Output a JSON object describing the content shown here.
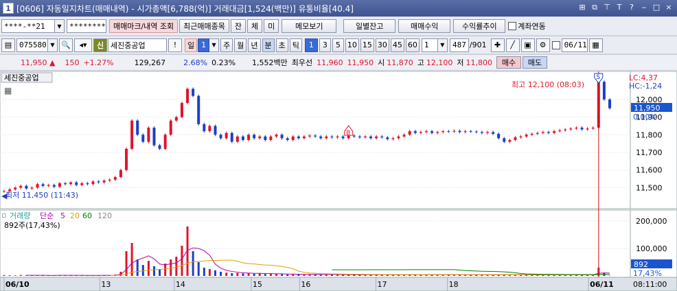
{
  "window": {
    "number": "1",
    "title": "[0606] 자동일지차트(매매내역) - 시가총액[6,788(억)] 거래대금[1,524(백만)] 유통비율[40.4]",
    "controls": [
      "⊞",
      "⧉",
      "⊤",
      "T",
      "?",
      "‒",
      "□",
      "×"
    ]
  },
  "toolbar1": {
    "account": "****-**21",
    "password": "********",
    "btn_trade_mark": "매매마크/내역 조회",
    "btn_recent": "최근매매종목",
    "btn_jan": "잔",
    "btn_che": "체",
    "btn_mi": "미",
    "btn_memo": "메모보기",
    "btn_daily_balance": "일별잔고",
    "btn_trade_profit": "매매수익",
    "btn_return_trend": "수익률추이",
    "account_link_label": "계좌연동"
  },
  "toolbar2": {
    "code": "075580",
    "badge": "신",
    "stock_name": "세진중공업",
    "excl": "!",
    "period_day": "일",
    "period_num": "1",
    "periods": [
      "주",
      "월",
      "년",
      "분",
      "초",
      "틱"
    ],
    "intervals": [
      "1",
      "3",
      "5",
      "10",
      "15",
      "30",
      "45",
      "60"
    ],
    "interval_input": "1",
    "count": "487",
    "total": "/901",
    "date": "06/11"
  },
  "quote": {
    "price": "11,950 ▲",
    "change": "150",
    "change_pct": "+1.27%",
    "volume": "129,267",
    "vol_ratio": "2.68%",
    "turnover": "0.23%",
    "amount": "1,552백만",
    "best_ask_label": "최우선",
    "best_ask": "11,960",
    "best_bid": "11,950",
    "open_label": "시",
    "open": "11,870",
    "high_label": "고",
    "high": "12,100",
    "low_label": "저",
    "low": "11,800",
    "buy_btn": "매수",
    "sell_btn": "매도"
  },
  "chart": {
    "stock_label": "세진중공업",
    "high_annot": "최고 12,100 (08:03)",
    "low_annot": "최저 11,450 (11:43)",
    "lc": "LC:4,37",
    "hc": "HC:-1,24",
    "current_price_tag": "11,950",
    "current_pct_tag": "0,00%",
    "volume_legend": {
      "title": "거래량",
      "ma_label": "단순",
      "ma": [
        "5",
        "20",
        "60",
        "120"
      ],
      "ma_colors": [
        "#b000b0",
        "#e0a000",
        "#008000",
        "#888888"
      ]
    },
    "volume_info": "892주(17,43%)",
    "volume_tag": "892",
    "volume_pct_tag": "17,43%",
    "date_labels": [
      "06/10",
      "13",
      "14",
      "15",
      "16",
      "17",
      "18",
      "06/11"
    ],
    "time_label": "08:11:00",
    "marker_b": "B",
    "marker_s": "S"
  },
  "chart_data": {
    "type": "line",
    "title": "",
    "price_axis": {
      "ticks": [
        11500,
        11600,
        11700,
        11800,
        11900,
        12000
      ],
      "ylim": [
        11420,
        12120
      ]
    },
    "volume_axis": {
      "ticks": [
        100000,
        200000
      ],
      "ylim": [
        0,
        220000
      ]
    },
    "x_labels": [
      "06/10",
      "13",
      "14",
      "15",
      "16",
      "17",
      "18",
      "06/11"
    ],
    "price_series": [
      11480,
      11490,
      11500,
      11510,
      11495,
      11500,
      11520,
      11510,
      11515,
      11505,
      11525,
      11520,
      11530,
      11515,
      11525,
      11520,
      11535,
      11530,
      11540,
      11545,
      11560,
      11600,
      11720,
      11880,
      11800,
      11760,
      11840,
      11740,
      11720,
      11800,
      11880,
      11900,
      11980,
      12060,
      12020,
      11860,
      11820,
      11850,
      11800,
      11780,
      11810,
      11760,
      11790,
      11770,
      11800,
      11780,
      11790,
      11770,
      11790,
      11800,
      11780,
      11770,
      11790,
      11780,
      11790,
      11795,
      11790,
      11780,
      11790,
      11785,
      11790,
      11780,
      11795,
      11790,
      11785,
      11790,
      11780,
      11790,
      11785,
      11775,
      11780,
      11790,
      11800,
      11820,
      11810,
      11815,
      11820,
      11810,
      11815,
      11820,
      11818,
      11822,
      11815,
      11820,
      11818,
      11815,
      11810,
      11815,
      11805,
      11780,
      11760,
      11770,
      11785,
      11790,
      11800,
      11805,
      11810,
      11815,
      11810,
      11820,
      11825,
      11830,
      11835,
      11840,
      11830,
      11835,
      11840,
      12100,
      12000,
      11950
    ],
    "volume_series": [
      3000,
      2500,
      2000,
      3500,
      2000,
      1500,
      2500,
      2000,
      1800,
      2200,
      2400,
      1900,
      2100,
      1800,
      2000,
      2300,
      1900,
      2100,
      2200,
      2500,
      5000,
      15000,
      90000,
      120000,
      60000,
      40000,
      55000,
      35000,
      25000,
      45000,
      60000,
      70000,
      110000,
      180000,
      90000,
      50000,
      30000,
      25000,
      20000,
      15000,
      12000,
      10000,
      11000,
      9000,
      10000,
      8000,
      9000,
      7000,
      8000,
      7500,
      6000,
      5500,
      6500,
      5000,
      5800,
      5200,
      5600,
      4800,
      5300,
      5000,
      4500,
      4200,
      4800,
      4300,
      4100,
      4600,
      4000,
      4400,
      4200,
      3900,
      4100,
      4300,
      4800,
      5200,
      4700,
      4500,
      4900,
      4400,
      4600,
      4800,
      4500,
      4700,
      4300,
      4600,
      4400,
      4200,
      4000,
      4300,
      3900,
      4500,
      5000,
      4200,
      4100,
      3800,
      4000,
      3700,
      3900,
      3600,
      3800,
      4000,
      4200,
      3900,
      4100,
      3800,
      4000,
      4200,
      4500,
      30000,
      12000,
      892
    ]
  }
}
